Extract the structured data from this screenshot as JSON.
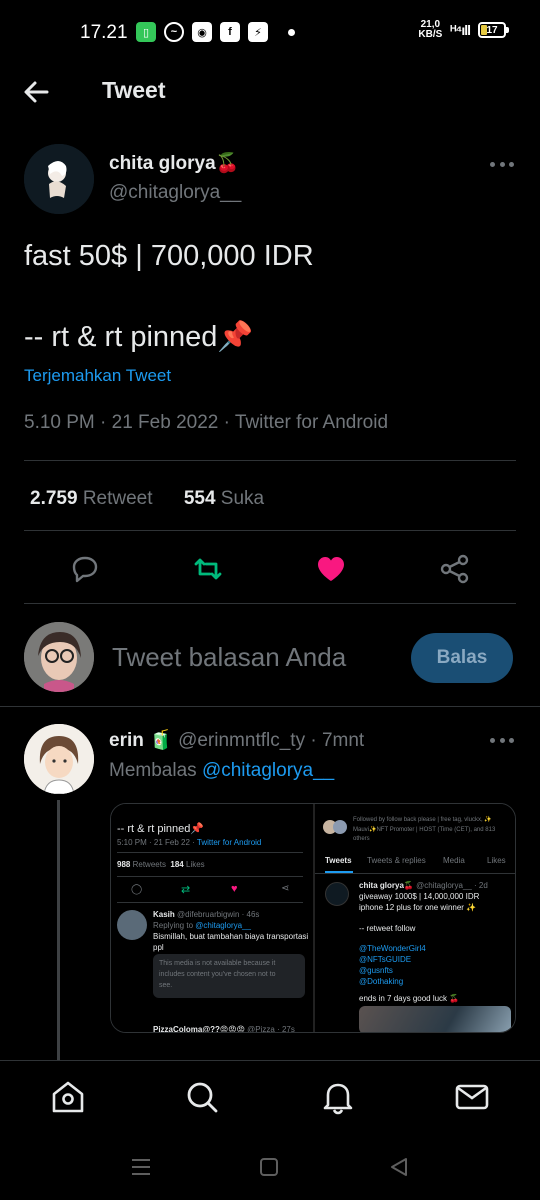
{
  "status_bar": {
    "time": "17.21",
    "speed_value": "21,0",
    "speed_unit": "KB/S",
    "battery": "17",
    "icons": [
      "battery-saver-icon",
      "messenger-icon",
      "app-icon",
      "facebook-icon",
      "shield-icon"
    ]
  },
  "header": {
    "title": "Tweet"
  },
  "tweet": {
    "author_name": "chita glorya🍒",
    "author_handle": "@chitaglorya__",
    "line1": "fast 50$ | 700,000 IDR",
    "line2": "-- rt & rt pinned📌",
    "translate": "Terjemahkan Tweet",
    "meta": "5.10 PM · 21 Feb 2022 · Twitter for Android",
    "retweets_count": "2.759",
    "retweets_label": "Retweet",
    "likes_count": "554",
    "likes_label": "Suka"
  },
  "composer": {
    "placeholder": "Tweet balasan Anda",
    "button": "Balas"
  },
  "reply": {
    "name": "erin 🧃",
    "handle": "@erinmntflc_ty",
    "time": "· 7mnt",
    "replying_prefix": "Membalas",
    "replying_to": "@chitaglorya__"
  },
  "embed": {
    "left": {
      "text": "-- rt & rt pinned📌",
      "meta": "5:10 PM · 21 Feb 22 · ",
      "meta_link": "Twitter for Android",
      "rt_count": "988",
      "rt_label": "Retweets",
      "like_count": "184",
      "like_label": "Likes",
      "reply_name": "Kasih",
      "reply_handle": "@difebruarbigwin · 46s",
      "replying": "Replying to ",
      "replying_link": "@chitaglorya__",
      "reply_text1": "Bismillah, buat tambahan biaya transportasi",
      "reply_text2": "ppl",
      "notice1": "This media is not available because it",
      "notice2": "includes content you've chosen not to",
      "notice3": "see.",
      "next_name": "PizzaColoma@??😡😡😡",
      "next_meta": "@Pizza · 27s"
    },
    "right": {
      "followed1": "Followed by follow back please | free tag, vluckx, ✨",
      "followed2": "Mauvi✨NFT Promoter | HOST (Time (CET), and 813",
      "followed3": "others",
      "tabs": [
        "Tweets",
        "Tweets & replies",
        "Media",
        "Likes"
      ],
      "name": "chita glorya🍒",
      "handle": "@chitaglorya__ · 2d",
      "text1": "giveaway 1000$ | 14,000,000 IDR",
      "text2": "iphone 12 plus for one winner ✨",
      "text3": "-- retweet follow",
      "mentions": [
        "@TheWonderGirl4",
        "@NFTsGUIDE",
        "@gusnfts",
        "@Dothaking"
      ],
      "ends": "ends in 7 days good luck 🍒"
    }
  }
}
